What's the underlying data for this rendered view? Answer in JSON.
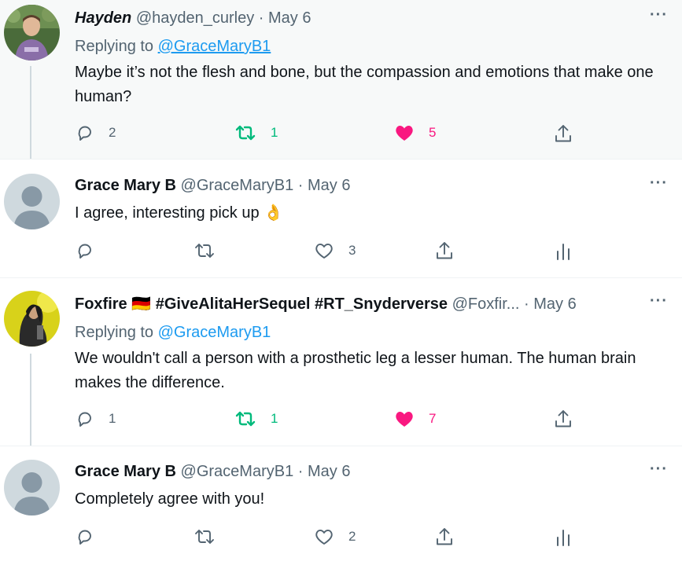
{
  "tweets": [
    {
      "name": "Hayden",
      "handle": "@hayden_curley",
      "dot": "·",
      "date": "May 6",
      "replying_prefix": "Replying to",
      "replying_handle": "@GraceMaryB1",
      "text": "Maybe it’s not the flesh and bone, but the compassion and emotions that make one human?",
      "reply_count": "2",
      "retweet_count": "1",
      "like_count": "5",
      "more": "···"
    },
    {
      "name": "Grace Mary B",
      "handle": "@GraceMaryB1",
      "dot": "·",
      "date": "May 6",
      "text": "I agree, interesting pick up",
      "emoji": "👌",
      "like_count": "3",
      "more": "···"
    },
    {
      "name": "Foxfire",
      "flag": "🇩🇪",
      "hashtags": "#GiveAlitaHerSequel #RT_Snyderverse",
      "handle": "@Foxfir...",
      "dot": "·",
      "date": "May 6",
      "replying_prefix": "Replying to",
      "replying_handle": "@GraceMaryB1",
      "text": "We wouldn't call a person with a prosthetic leg a lesser human. The human brain makes the difference.",
      "reply_count": "1",
      "retweet_count": "1",
      "like_count": "7",
      "more": "···"
    },
    {
      "name": "Grace Mary B",
      "handle": "@GraceMaryB1",
      "dot": "·",
      "date": "May 6",
      "text": "Completely agree with you!",
      "like_count": "2",
      "more": "···"
    }
  ],
  "colors": {
    "accent": "#1d9bf0",
    "retweet_active": "#00ba7c",
    "like_active": "#f91880",
    "muted": "#536471"
  }
}
